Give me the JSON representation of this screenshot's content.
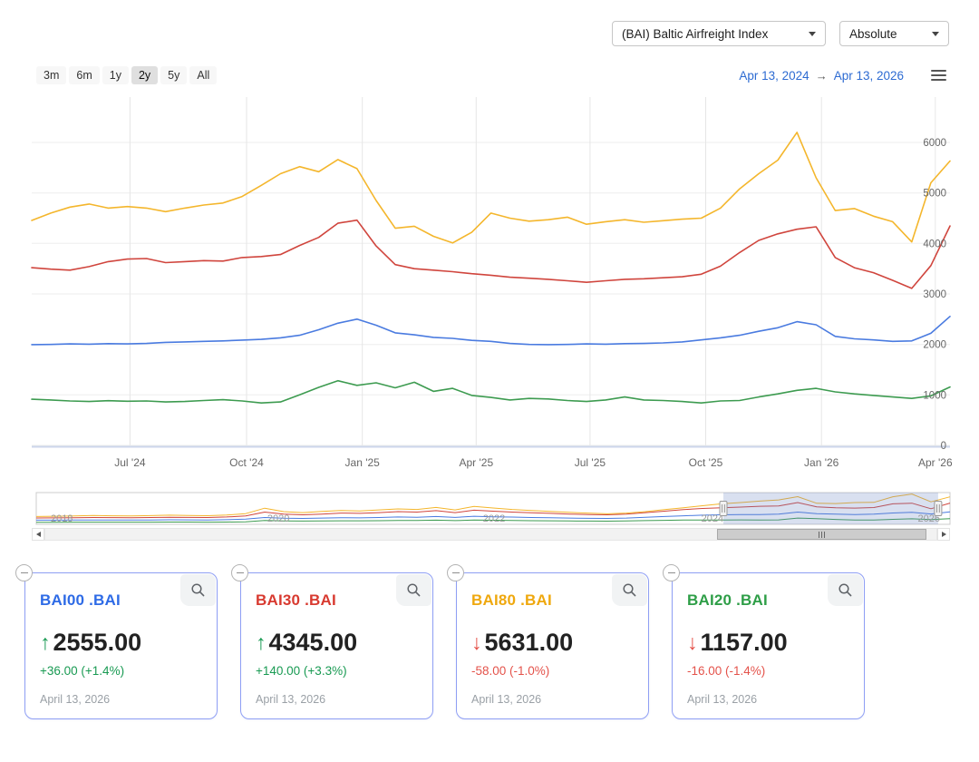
{
  "header": {
    "index_select": {
      "value": "(BAI) Baltic Airfreight Index"
    },
    "mode_select": {
      "value": "Absolute"
    }
  },
  "toolbar": {
    "ranges": [
      {
        "label": "3m",
        "selected": false
      },
      {
        "label": "6m",
        "selected": false
      },
      {
        "label": "1y",
        "selected": false
      },
      {
        "label": "2y",
        "selected": true
      },
      {
        "label": "5y",
        "selected": false
      },
      {
        "label": "All",
        "selected": false
      }
    ],
    "date_from": "Apr 13, 2024",
    "range_arrow": "→",
    "date_to": "Apr 13, 2026"
  },
  "theme": {
    "up_color": "#189a52",
    "down_color": "#e4524a",
    "grid_color": "#e6e6e6",
    "hgrid_color": "#ededed",
    "axis_line_color": "#ccd6eb",
    "tick_label_color": "#666666",
    "nav_label_color": "#999999",
    "selection_fill": "rgba(102,133,194,0.25)"
  },
  "chart_data": {
    "main": {
      "type": "line",
      "title": "",
      "x_range": [
        "Apr 13, 2024",
        "Apr 13, 2026"
      ],
      "x_tick_labels": [
        "Jul '24",
        "Oct '24",
        "Jan '25",
        "Apr '25",
        "Jul '25",
        "Oct '25",
        "Jan '26",
        "Apr '26"
      ],
      "x_tick_fracs": [
        0.107,
        0.234,
        0.36,
        0.484,
        0.608,
        0.734,
        0.86,
        0.984
      ],
      "y_ticks": [
        0,
        1000,
        2000,
        3000,
        4000,
        5000,
        6000
      ],
      "ylim": [
        0,
        6400
      ],
      "grid": true,
      "legend": "none",
      "series": [
        {
          "name": "BAI00 .BAI",
          "color": "#4a7be0",
          "values": [
            1995,
            2000,
            2010,
            2005,
            2015,
            2010,
            2020,
            2040,
            2050,
            2060,
            2070,
            2085,
            2100,
            2130,
            2180,
            2290,
            2420,
            2500,
            2380,
            2230,
            2190,
            2140,
            2120,
            2080,
            2060,
            2020,
            2000,
            1995,
            2000,
            2010,
            2005,
            2015,
            2020,
            2030,
            2050,
            2090,
            2130,
            2180,
            2260,
            2330,
            2450,
            2390,
            2160,
            2110,
            2090,
            2060,
            2070,
            2220,
            2555
          ]
        },
        {
          "name": "BAI30 .BAI",
          "color": "#d0453d",
          "values": [
            3520,
            3490,
            3470,
            3540,
            3640,
            3690,
            3700,
            3620,
            3640,
            3660,
            3650,
            3720,
            3740,
            3780,
            3960,
            4120,
            4400,
            4460,
            3950,
            3580,
            3500,
            3470,
            3440,
            3400,
            3370,
            3330,
            3310,
            3290,
            3260,
            3230,
            3260,
            3290,
            3300,
            3320,
            3340,
            3390,
            3550,
            3820,
            4060,
            4190,
            4280,
            4330,
            3720,
            3520,
            3420,
            3270,
            3110,
            3560,
            4345
          ]
        },
        {
          "name": "BAI80 .BAI",
          "color": "#f4b62c",
          "values": [
            4455,
            4600,
            4720,
            4780,
            4700,
            4730,
            4700,
            4630,
            4700,
            4760,
            4800,
            4930,
            5150,
            5380,
            5520,
            5420,
            5660,
            5480,
            4850,
            4300,
            4340,
            4140,
            4010,
            4220,
            4600,
            4500,
            4440,
            4470,
            4520,
            4380,
            4430,
            4470,
            4420,
            4450,
            4480,
            4500,
            4700,
            5080,
            5380,
            5650,
            6200,
            5300,
            4650,
            4690,
            4540,
            4430,
            4030,
            5200,
            5631
          ]
        },
        {
          "name": "BAI20 .BAI",
          "color": "#3d9b50",
          "values": [
            915,
            900,
            880,
            870,
            885,
            875,
            880,
            860,
            870,
            890,
            905,
            880,
            840,
            860,
            1000,
            1150,
            1280,
            1190,
            1240,
            1140,
            1250,
            1070,
            1130,
            990,
            950,
            900,
            930,
            920,
            890,
            870,
            900,
            960,
            900,
            890,
            870,
            840,
            880,
            890,
            960,
            1020,
            1090,
            1130,
            1060,
            1020,
            990,
            960,
            930,
            980,
            1157
          ]
        }
      ]
    },
    "navigator": {
      "type": "line",
      "x_range": [
        "2018",
        "2026"
      ],
      "year_ticks": [
        {
          "label": "2018",
          "frac": 0.028
        },
        {
          "label": "2020",
          "frac": 0.265
        },
        {
          "label": "2022",
          "frac": 0.501
        },
        {
          "label": "2024",
          "frac": 0.74
        },
        {
          "label": "2026",
          "frac": 0.977
        }
      ],
      "ylim": [
        0,
        6500
      ],
      "selection": {
        "start_frac": 0.752,
        "end_frac": 0.987
      },
      "series": [
        {
          "name": "BAI00 .BAI",
          "color": "#4a7be0",
          "values": [
            850,
            860,
            880,
            900,
            890,
            880,
            900,
            920,
            910,
            900,
            950,
            1050,
            1400,
            1250,
            1200,
            1280,
            1350,
            1320,
            1400,
            1500,
            1450,
            1600,
            1420,
            1650,
            1550,
            1480,
            1400,
            1350,
            1280,
            1230,
            1200,
            1280,
            1450,
            1600,
            1750,
            1880,
            1950,
            1995,
            2010,
            2085,
            2500,
            2190,
            2080,
            2010,
            2090,
            2330,
            2450,
            2110,
            2555
          ]
        },
        {
          "name": "BAI30 .BAI",
          "color": "#d0453d",
          "values": [
            1300,
            1320,
            1350,
            1400,
            1380,
            1360,
            1400,
            1450,
            1420,
            1400,
            1500,
            1700,
            2500,
            2100,
            1950,
            2100,
            2300,
            2250,
            2400,
            2600,
            2500,
            2800,
            2400,
            2900,
            2700,
            2500,
            2350,
            2250,
            2100,
            2000,
            1950,
            2100,
            2400,
            2700,
            3000,
            3250,
            3400,
            3520,
            3700,
            3750,
            4460,
            3580,
            3400,
            3320,
            3430,
            4190,
            4330,
            3200,
            4345
          ]
        },
        {
          "name": "BAI80 .BAI",
          "color": "#f4b62c",
          "values": [
            1600,
            1650,
            1720,
            1800,
            1740,
            1700,
            1780,
            1870,
            1820,
            1760,
            1900,
            2200,
            3300,
            2600,
            2400,
            2650,
            2850,
            2750,
            2950,
            3150,
            3050,
            3450,
            2950,
            3650,
            3350,
            3050,
            2850,
            2650,
            2450,
            2300,
            2150,
            2300,
            2600,
            3000,
            3400,
            3800,
            4200,
            4455,
            4750,
            5000,
            5660,
            4300,
            4250,
            4450,
            4500,
            5650,
            6200,
            4600,
            5631
          ]
        },
        {
          "name": "BAI20 .BAI",
          "color": "#3d9b50",
          "values": [
            420,
            430,
            440,
            450,
            445,
            440,
            450,
            460,
            455,
            450,
            470,
            520,
            800,
            700,
            670,
            700,
            730,
            720,
            750,
            800,
            780,
            850,
            760,
            880,
            830,
            790,
            750,
            720,
            690,
            670,
            650,
            690,
            760,
            820,
            870,
            890,
            900,
            915,
            880,
            915,
            1280,
            1150,
            1000,
            900,
            870,
            1020,
            1130,
            980,
            1157
          ]
        }
      ]
    }
  },
  "cards": [
    {
      "symbol": "BAI00 .BAI",
      "accent": "#2e6be6",
      "direction": "up",
      "value": "2555.00",
      "change": "+36.00 (+1.4%)",
      "date": "April 13, 2026"
    },
    {
      "symbol": "BAI30 .BAI",
      "accent": "#d83a30",
      "direction": "up",
      "value": "4345.00",
      "change": "+140.00 (+3.3%)",
      "date": "April 13, 2026"
    },
    {
      "symbol": "BAI80 .BAI",
      "accent": "#efa80e",
      "direction": "down",
      "value": "5631.00",
      "change": "-58.00 (-1.0%)",
      "date": "April 13, 2026"
    },
    {
      "symbol": "BAI20 .BAI",
      "accent": "#2e9e47",
      "direction": "down",
      "value": "1157.00",
      "change": "-16.00 (-1.4%)",
      "date": "April 13, 2026"
    }
  ]
}
